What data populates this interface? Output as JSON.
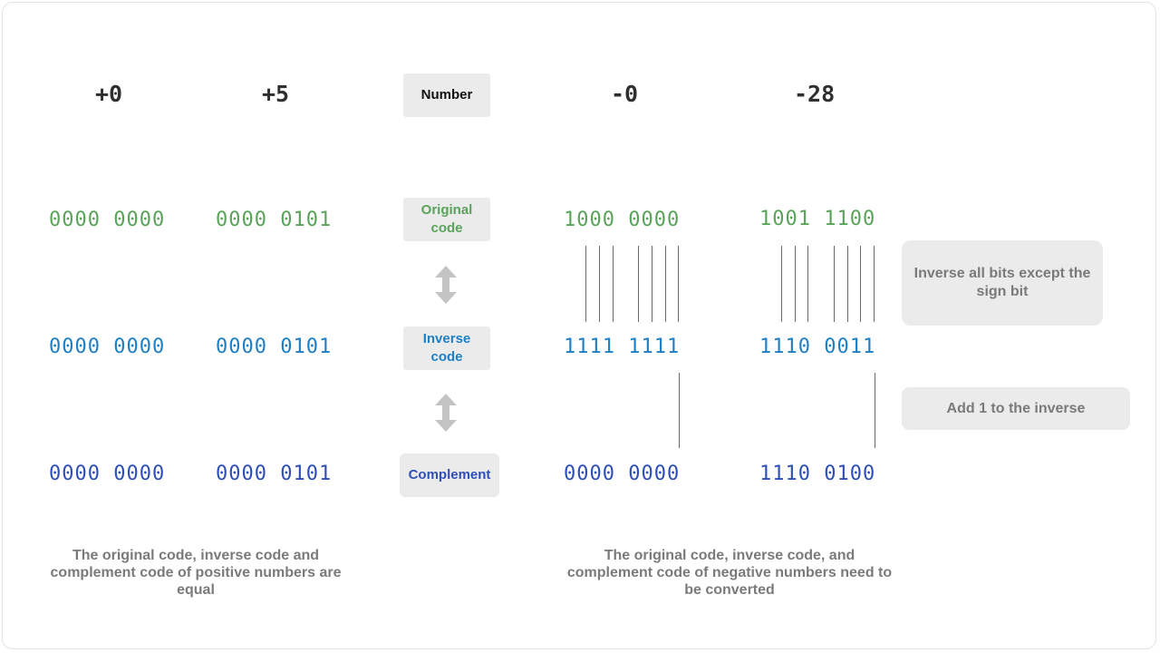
{
  "headers": {
    "pos_zero": "+0",
    "pos_five": "+5",
    "neg_zero": "-0",
    "neg_28": "-28"
  },
  "row_labels": {
    "number": "Number",
    "original": "Original code",
    "inverse": "Inverse code",
    "complement": "Complement"
  },
  "pos_zero": {
    "original": "0000 0000",
    "inverse": "0000 0000",
    "complement": "0000 0000"
  },
  "pos_five": {
    "original": "0000 0101",
    "inverse": "0000 0101",
    "complement": "0000 0101"
  },
  "neg_zero": {
    "original": "1000 0000",
    "inverse": "1111 1111",
    "complement": "0000 0000"
  },
  "neg_28": {
    "original": "1001 1100",
    "inverse": "1110 0011",
    "complement": "1110 0100"
  },
  "notes": {
    "invert": "Inverse all bits except the sign bit",
    "add_one": "Add 1 to the inverse"
  },
  "captions": {
    "positive": "The original code, inverse code and complement code of positive numbers are equal",
    "negative": "The original code, inverse code, and complement code of negative numbers need to be converted"
  },
  "colors": {
    "original": "#5aa35a",
    "inverse": "#1f7fc4",
    "complement": "#2f4fb8",
    "box": "#ebebeb",
    "arrow": "#c4c4c4"
  },
  "icons": {
    "arrow": "double-headed-vertical-arrow"
  }
}
